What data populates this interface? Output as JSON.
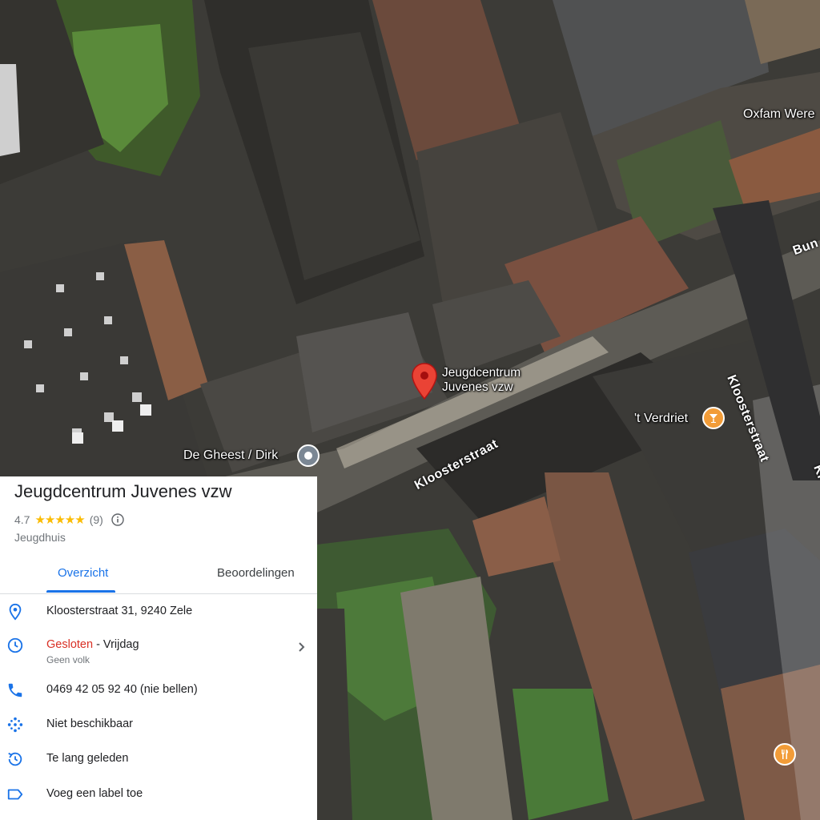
{
  "map": {
    "place_pin_label": [
      "Jeugdcentrum",
      "Juvenes vzw"
    ],
    "poi_labels": {
      "oxfam": "Oxfam Were",
      "verdriet": "'t Verdriet",
      "ghees": "De Gheest / Dirk"
    },
    "streets": {
      "kloosterstraat_main": "Kloosterstraat",
      "kloosterstraat_vertical": "Kloosterstraat",
      "bun": "Bun",
      "kl_edge": "Kl"
    }
  },
  "panel": {
    "title": "Jeugdcentrum Juvenes vzw",
    "rating": "4.7",
    "stars": "★★★★★",
    "review_count": "(9)",
    "category": "Jeugdhuis",
    "tabs": [
      "Overzicht",
      "Beoordelingen"
    ],
    "address": "Kloosterstraat 31, 9240 Zele",
    "hours_status": "Gesloten",
    "hours_day": " - Vrijdag",
    "hours_sub": "Geen volk",
    "phone": "0469 42 05 92 40 (nie bellen)",
    "plus_code": "Niet beschikbaar",
    "history": "Te lang geleden",
    "label": "Voeg een label toe"
  },
  "colors": {
    "accent": "#1a73e8",
    "closed": "#d93025",
    "star": "#fbbc04",
    "pin": "#ea4335",
    "poi_orange": "#f29c38",
    "poi_gray": "#7b8794"
  }
}
